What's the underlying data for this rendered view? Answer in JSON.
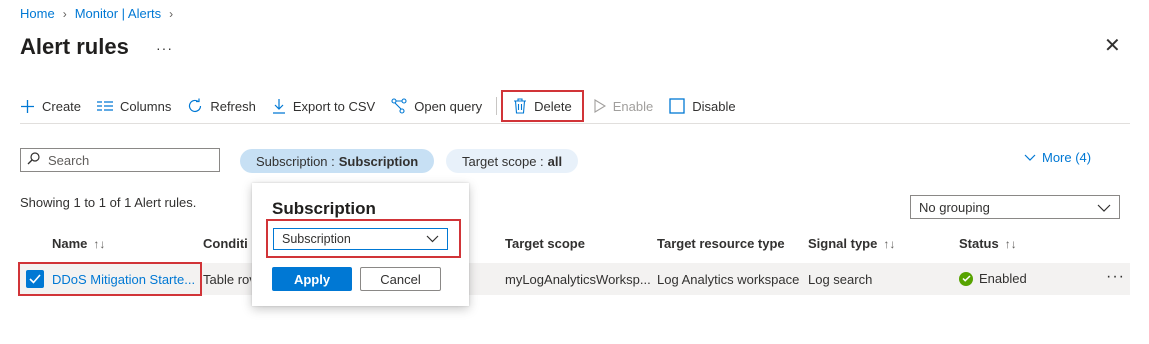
{
  "breadcrumb": [
    {
      "label": "Home"
    },
    {
      "label": "Monitor | Alerts"
    }
  ],
  "page_title": "Alert rules",
  "title_more": "···",
  "close_glyph": "✕",
  "toolbar": {
    "create": "Create",
    "columns": "Columns",
    "refresh": "Refresh",
    "export": "Export to CSV",
    "open_query": "Open query",
    "delete": "Delete",
    "enable": "Enable",
    "disable": "Disable"
  },
  "icons": {
    "create": "plus-icon",
    "columns": "columns-icon",
    "refresh": "refresh-icon",
    "export": "download-icon",
    "open_query": "query-icon",
    "delete": "trash-icon",
    "enable": "play-icon",
    "disable": "checkbox-empty-icon",
    "search": "search-icon",
    "chevron": "chevron-down-icon"
  },
  "search": {
    "placeholder": "Search"
  },
  "filters": {
    "subscription_label": "Subscription :",
    "subscription_value": "Subscription",
    "scope_label": "Target scope :",
    "scope_value": "all",
    "more": "More (4)"
  },
  "showing": "Showing 1 to 1 of 1 Alert rules.",
  "grouping": "No grouping",
  "table": {
    "columns": [
      "Name",
      "Conditi",
      "Target scope",
      "Target resource type",
      "Signal type",
      "Status"
    ],
    "rows": [
      {
        "name": "DDoS Mitigation Starte...",
        "condition": "Table rov",
        "target_scope": "myLogAnalyticsWorksp...",
        "resource_type": "Log Analytics workspace",
        "signal_type": "Log search",
        "status": "Enabled",
        "more": "···"
      }
    ]
  },
  "flyout": {
    "title": "Subscription",
    "select_value": "Subscription",
    "apply": "Apply",
    "cancel": "Cancel"
  },
  "colors": {
    "accent": "#0078d4",
    "highlight": "#d13438",
    "status_enabled": "#57a300"
  }
}
